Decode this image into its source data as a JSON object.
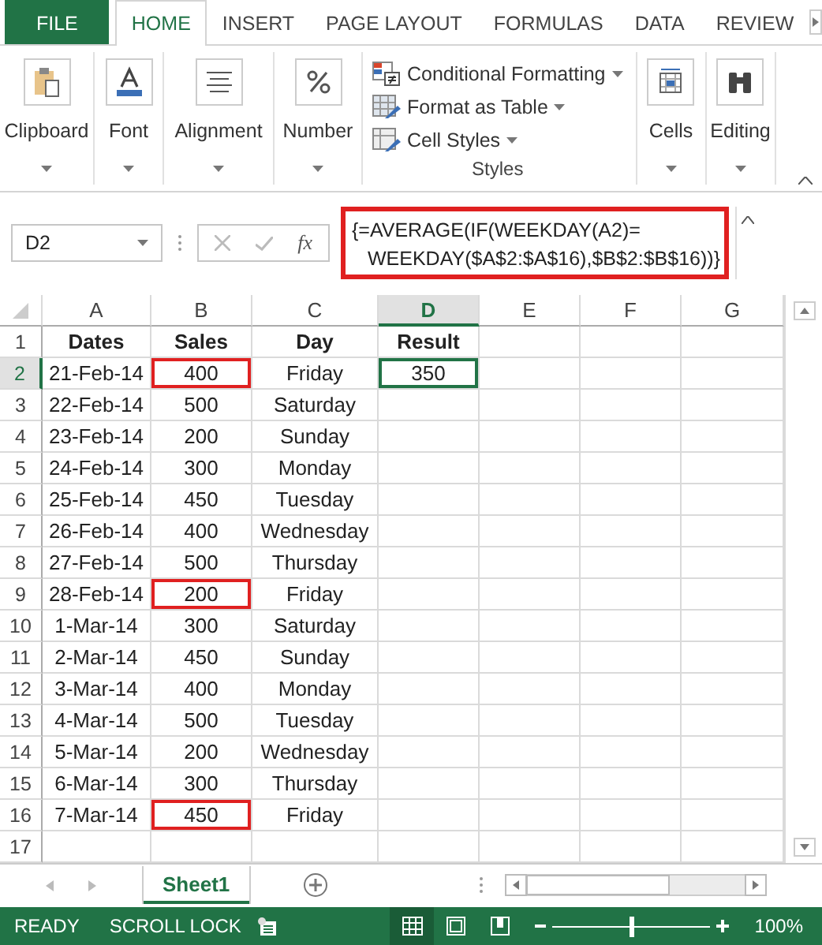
{
  "tabs": [
    {
      "label": "FILE",
      "kind": "file",
      "selected": false
    },
    {
      "label": "HOME",
      "kind": "tab",
      "selected": true
    },
    {
      "label": "INSERT",
      "kind": "tab",
      "selected": false
    },
    {
      "label": "PAGE LAYOUT",
      "kind": "tab",
      "selected": false
    },
    {
      "label": "FORMULAS",
      "kind": "tab",
      "selected": false
    },
    {
      "label": "DATA",
      "kind": "tab",
      "selected": false
    },
    {
      "label": "REVIEW",
      "kind": "tab",
      "selected": false
    }
  ],
  "ribbon": {
    "groups": [
      {
        "label": "Clipboard",
        "kind": "clipboard"
      },
      {
        "label": "Font",
        "kind": "font"
      },
      {
        "label": "Alignment",
        "kind": "alignment"
      },
      {
        "label": "Number",
        "kind": "number"
      }
    ],
    "styles": {
      "label": "Styles",
      "items": [
        {
          "label": "Conditional Formatting",
          "kind": "conditional"
        },
        {
          "label": "Format as Table",
          "kind": "table"
        },
        {
          "label": "Cell Styles",
          "kind": "cellstyles"
        }
      ]
    },
    "after": [
      {
        "label": "Cells",
        "kind": "cells"
      },
      {
        "label": "Editing",
        "kind": "editing"
      }
    ]
  },
  "formula_bar": {
    "name_box": "D2",
    "function_symbol": "fx",
    "formula_lines": [
      "{=AVERAGE(IF(WEEKDAY(A2)=",
      "WEEKDAY($A$2:$A$16),$B$2:$B$16))}"
    ]
  },
  "sheet": {
    "columns": [
      {
        "label": "A",
        "selected": false
      },
      {
        "label": "B",
        "selected": false
      },
      {
        "label": "C",
        "selected": false
      },
      {
        "label": "D",
        "selected": true
      },
      {
        "label": "E",
        "selected": false
      },
      {
        "label": "F",
        "selected": false
      },
      {
        "label": "G",
        "selected": false
      }
    ],
    "rows": [
      {
        "number": "1",
        "kind": "header",
        "selected": false,
        "cells": [
          "Dates",
          "Sales",
          "Day",
          "Result"
        ],
        "marked": false
      },
      {
        "number": "2",
        "kind": "data",
        "selected": true,
        "cells": [
          "21-Feb-14",
          "400",
          "Friday",
          "350"
        ],
        "marked": true
      },
      {
        "number": "3",
        "kind": "data",
        "selected": false,
        "cells": [
          "22-Feb-14",
          "500",
          "Saturday",
          ""
        ],
        "marked": false
      },
      {
        "number": "4",
        "kind": "data",
        "selected": false,
        "cells": [
          "23-Feb-14",
          "200",
          "Sunday",
          ""
        ],
        "marked": false
      },
      {
        "number": "5",
        "kind": "data",
        "selected": false,
        "cells": [
          "24-Feb-14",
          "300",
          "Monday",
          ""
        ],
        "marked": false
      },
      {
        "number": "6",
        "kind": "data",
        "selected": false,
        "cells": [
          "25-Feb-14",
          "450",
          "Tuesday",
          ""
        ],
        "marked": false
      },
      {
        "number": "7",
        "kind": "data",
        "selected": false,
        "cells": [
          "26-Feb-14",
          "400",
          "Wednesday",
          ""
        ],
        "marked": false
      },
      {
        "number": "8",
        "kind": "data",
        "selected": false,
        "cells": [
          "27-Feb-14",
          "500",
          "Thursday",
          ""
        ],
        "marked": false
      },
      {
        "number": "9",
        "kind": "data",
        "selected": false,
        "cells": [
          "28-Feb-14",
          "200",
          "Friday",
          ""
        ],
        "marked": true
      },
      {
        "number": "10",
        "kind": "data",
        "selected": false,
        "cells": [
          "1-Mar-14",
          "300",
          "Saturday",
          ""
        ],
        "marked": false
      },
      {
        "number": "11",
        "kind": "data",
        "selected": false,
        "cells": [
          "2-Mar-14",
          "450",
          "Sunday",
          ""
        ],
        "marked": false
      },
      {
        "number": "12",
        "kind": "data",
        "selected": false,
        "cells": [
          "3-Mar-14",
          "400",
          "Monday",
          ""
        ],
        "marked": false
      },
      {
        "number": "13",
        "kind": "data",
        "selected": false,
        "cells": [
          "4-Mar-14",
          "500",
          "Tuesday",
          ""
        ],
        "marked": false
      },
      {
        "number": "14",
        "kind": "data",
        "selected": false,
        "cells": [
          "5-Mar-14",
          "200",
          "Wednesday",
          ""
        ],
        "marked": false
      },
      {
        "number": "15",
        "kind": "data",
        "selected": false,
        "cells": [
          "6-Mar-14",
          "300",
          "Thursday",
          ""
        ],
        "marked": false
      },
      {
        "number": "16",
        "kind": "data",
        "selected": false,
        "cells": [
          "7-Mar-14",
          "450",
          "Friday",
          ""
        ],
        "marked": true
      },
      {
        "number": "17",
        "kind": "data",
        "selected": false,
        "cells": [
          "",
          "",
          "",
          ""
        ],
        "marked": false
      }
    ]
  },
  "sheet_tabs": [
    {
      "label": "Sheet1",
      "selected": true
    }
  ],
  "status_bar": {
    "mode": "READY",
    "scroll_lock": "SCROLL LOCK",
    "zoom": {
      "level": 0.5,
      "reading": "100%"
    }
  }
}
